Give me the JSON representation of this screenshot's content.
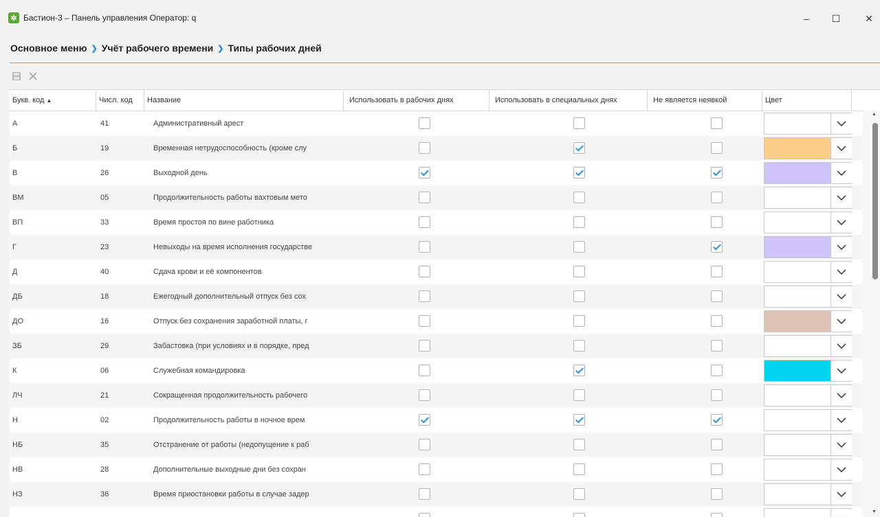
{
  "window": {
    "title": "Бастион-3 – Панель управления Оператор: q",
    "minimize_glyph": "–",
    "maximize_glyph": "☐",
    "close_glyph": "✕"
  },
  "breadcrumb": [
    "Основное меню",
    "Учёт рабочего времени",
    "Типы рабочих дней"
  ],
  "toolbar": {
    "save_icon": "save-icon",
    "delete_icon": "delete-icon"
  },
  "table": {
    "sort_indicator": "▲",
    "columns": [
      "Букв. код",
      "Числ. код",
      "Название",
      "Использовать в рабочих днях",
      "Использовать в специальных днях",
      "Не является неявкой",
      "Цвет"
    ],
    "rows": [
      {
        "code": "А",
        "num": "41",
        "name": "Административный арест",
        "work": false,
        "special": false,
        "notabs": false,
        "color": "#ffffff"
      },
      {
        "code": "Б",
        "num": "19",
        "name": "Временная нетрудоспособность (кроме слу",
        "work": false,
        "special": true,
        "notabs": false,
        "color": "#fbcd88"
      },
      {
        "code": "В",
        "num": "26",
        "name": "Выходной день",
        "work": true,
        "special": true,
        "notabs": true,
        "color": "#cdc2fa"
      },
      {
        "code": "ВМ",
        "num": "05",
        "name": "Продолжительность работы вахтовым мето",
        "work": false,
        "special": false,
        "notabs": false,
        "color": "#ffffff"
      },
      {
        "code": "ВП",
        "num": "33",
        "name": "Время простоя по вине работника",
        "work": false,
        "special": false,
        "notabs": false,
        "color": "#ffffff"
      },
      {
        "code": "Г",
        "num": "23",
        "name": "Невыходы на время исполнения государстве",
        "work": false,
        "special": false,
        "notabs": true,
        "color": "#cdc2fa"
      },
      {
        "code": "Д",
        "num": "40",
        "name": "Сдача крови и её компонентов",
        "work": false,
        "special": false,
        "notabs": false,
        "color": "#ffffff"
      },
      {
        "code": "ДБ",
        "num": "18",
        "name": "Ежегодный дополнительный отпуск без сох",
        "work": false,
        "special": false,
        "notabs": false,
        "color": "#ffffff"
      },
      {
        "code": "ДО",
        "num": "16",
        "name": "Отпуск без сохранения заработной платы, г",
        "work": false,
        "special": false,
        "notabs": false,
        "color": "#dcc3b4"
      },
      {
        "code": "ЗБ",
        "num": "29",
        "name": "Забастовка (при условиях и в порядке, пред",
        "work": false,
        "special": false,
        "notabs": false,
        "color": "#ffffff"
      },
      {
        "code": "К",
        "num": "06",
        "name": "Служебная командировка",
        "work": false,
        "special": true,
        "notabs": false,
        "color": "#00d4f0"
      },
      {
        "code": "ЛЧ",
        "num": "21",
        "name": "Сокращенная продолжительность рабочего",
        "work": false,
        "special": false,
        "notabs": false,
        "color": "#ffffff"
      },
      {
        "code": "Н",
        "num": "02",
        "name": "Продолжительность работы в ночное врем",
        "work": true,
        "special": true,
        "notabs": true,
        "color": "#ffffff"
      },
      {
        "code": "НБ",
        "num": "35",
        "name": "Отстранение от работы (недопущение к раб",
        "work": false,
        "special": false,
        "notabs": false,
        "color": "#ffffff"
      },
      {
        "code": "НВ",
        "num": "28",
        "name": "Дополнительные выходные дни без сохран",
        "work": false,
        "special": false,
        "notabs": false,
        "color": "#ffffff"
      },
      {
        "code": "НЗ",
        "num": "36",
        "name": "Время приостановки работы в случае задер",
        "work": false,
        "special": false,
        "notabs": false,
        "color": "#ffffff"
      },
      {
        "code": "",
        "num": "",
        "name": "",
        "work": false,
        "special": false,
        "notabs": false,
        "color": "#ffffff"
      }
    ]
  }
}
